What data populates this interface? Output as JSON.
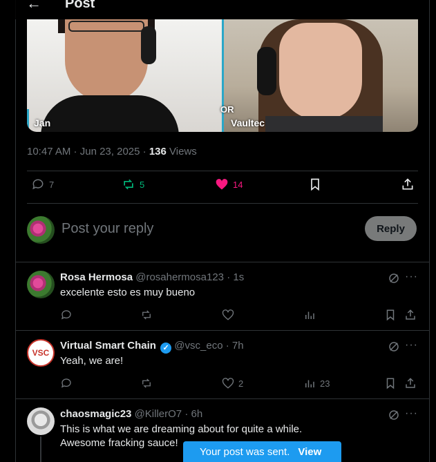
{
  "header": {
    "back_icon": "arrow-left-icon",
    "title": "Post"
  },
  "video": {
    "left_name": "Jan",
    "right_name": "Vaultec",
    "overlay_text": "OR"
  },
  "post_meta": {
    "time": "10:47 AM",
    "date": "Jun 23, 2025",
    "views_count": "136",
    "views_label": "Views"
  },
  "post_actions": {
    "replies": "7",
    "reposts": "5",
    "likes": "14"
  },
  "reply_composer": {
    "placeholder": "Post your reply",
    "button_label": "Reply"
  },
  "replies": [
    {
      "name": "Rosa Hermosa",
      "handle": "@rosahermosa123",
      "time": "· 1s",
      "text": "excelente esto es muy bueno",
      "replies": "",
      "reposts": "",
      "likes": "",
      "views": ""
    },
    {
      "name": "Virtual Smart Chain",
      "avatar_text": "VSC",
      "handle": "@vsc_eco",
      "time": "· 7h",
      "text": "Yeah, we are!",
      "replies": "",
      "reposts": "",
      "likes": "2",
      "views": "23"
    },
    {
      "name": "chaosmagic23",
      "handle": "@KillerO7",
      "time": "· 6h",
      "text": "This is what we are dreaming about for quite a while. Awesome fracking sauce!"
    }
  ],
  "toast": {
    "message": "Your post was sent.",
    "action": "View"
  },
  "colors": {
    "accent": "#1d9bf0",
    "like": "#f91880",
    "repost": "#00ba7c",
    "muted": "#71767b"
  }
}
